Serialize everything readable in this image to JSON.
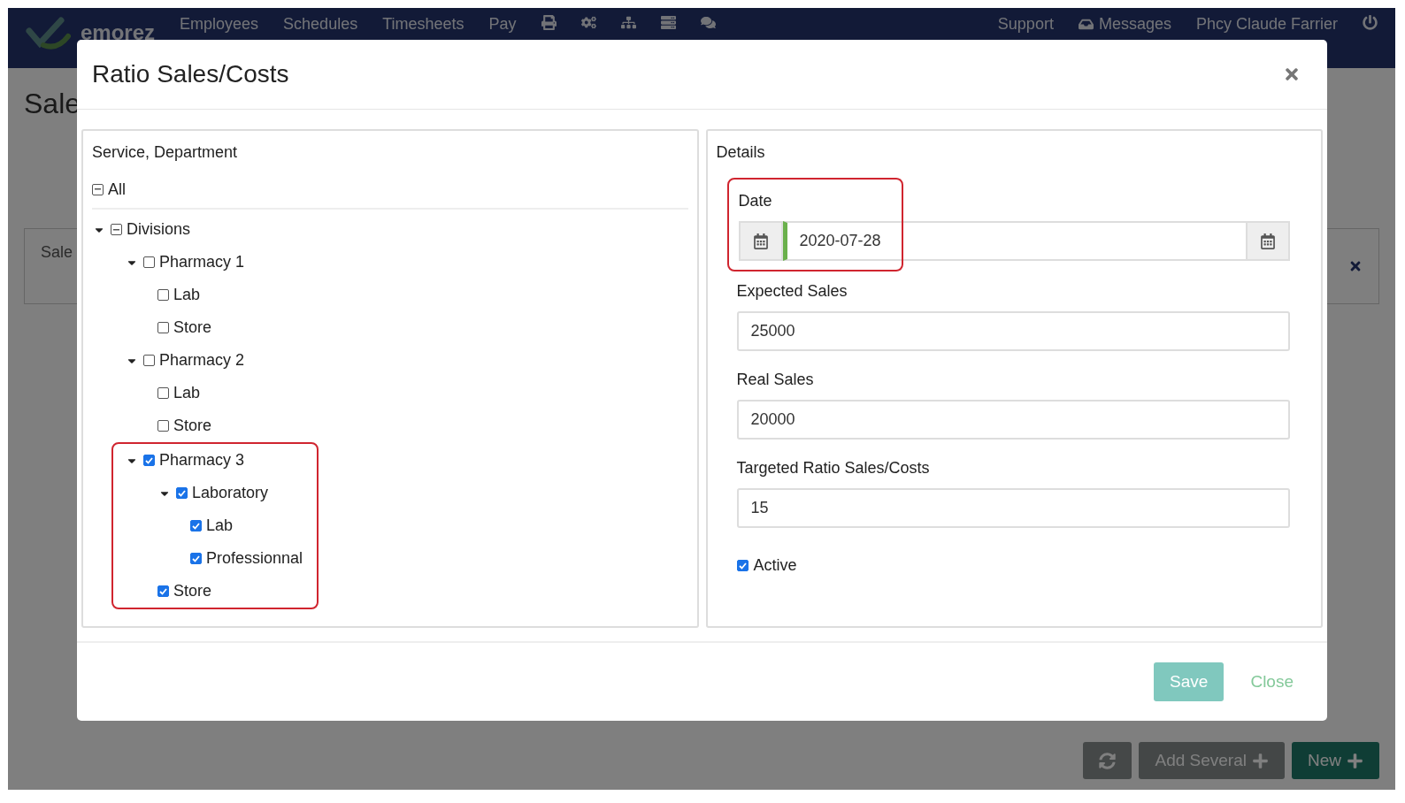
{
  "nav": {
    "logo": "emorez",
    "items": [
      "Employees",
      "Schedules",
      "Timesheets",
      "Pay"
    ],
    "support": "Support",
    "messages": "Messages",
    "user": "Phcy Claude Farrier"
  },
  "page": {
    "heading": "Sale",
    "card_label": "Sale",
    "buttons": [
      {
        "label": "Add Several",
        "kind": "dark"
      },
      {
        "label": "New",
        "kind": "primary"
      }
    ]
  },
  "modal": {
    "title": "Ratio Sales/Costs",
    "tree_panel": {
      "title": "Service, Department",
      "all": {
        "label": "All",
        "indeterminate": true
      },
      "nodes": [
        {
          "label": "Divisions",
          "indeterminate": true,
          "expanded": true,
          "highlighted": false,
          "children": [
            {
              "label": "Pharmacy 1",
              "checked": false,
              "indeterminate": false,
              "expanded": true,
              "highlighted": false,
              "children": [
                {
                  "label": "Lab",
                  "checked": false,
                  "indeterminate": false,
                  "highlighted": false
                },
                {
                  "label": "Store",
                  "checked": false,
                  "indeterminate": false,
                  "highlighted": false
                }
              ]
            },
            {
              "label": "Pharmacy 2",
              "checked": false,
              "indeterminate": false,
              "expanded": true,
              "highlighted": false,
              "children": [
                {
                  "label": "Lab",
                  "checked": false,
                  "indeterminate": false,
                  "highlighted": false
                },
                {
                  "label": "Store",
                  "checked": false,
                  "indeterminate": false,
                  "highlighted": false
                }
              ]
            },
            {
              "label": "Pharmacy 3",
              "checked": true,
              "indeterminate": false,
              "expanded": true,
              "highlighted": true,
              "children": [
                {
                  "label": "Laboratory",
                  "checked": true,
                  "indeterminate": false,
                  "expanded": true,
                  "highlighted": false,
                  "children": [
                    {
                      "label": "Lab",
                      "checked": true,
                      "indeterminate": false,
                      "highlighted": false
                    },
                    {
                      "label": "Professionnal",
                      "checked": true,
                      "indeterminate": false,
                      "highlighted": false
                    }
                  ]
                },
                {
                  "label": "Store",
                  "checked": true,
                  "indeterminate": false,
                  "highlighted": false
                }
              ]
            }
          ]
        }
      ]
    },
    "details": {
      "title": "Details",
      "date": {
        "label": "Date",
        "value": "2020-07-28",
        "highlighted": true
      },
      "fields": [
        {
          "label": "Expected Sales",
          "value": "25000"
        },
        {
          "label": "Real Sales",
          "value": "20000"
        },
        {
          "label": "Targeted Ratio Sales/Costs",
          "value": "15"
        }
      ],
      "active": {
        "label": "Active",
        "checked": true
      }
    },
    "footer": {
      "save": "Save",
      "close": "Close"
    }
  }
}
